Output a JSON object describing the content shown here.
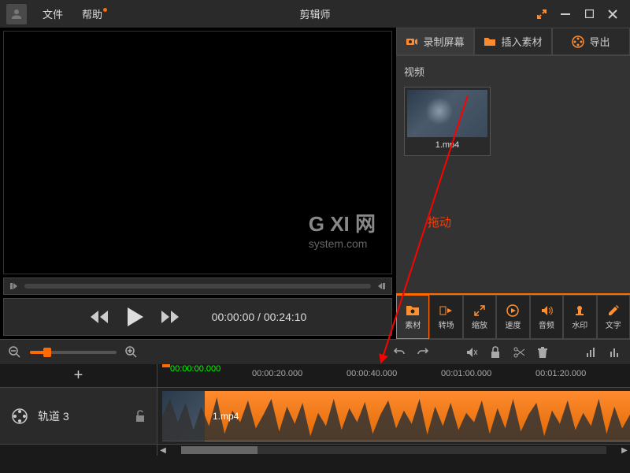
{
  "app": {
    "title": "剪辑师"
  },
  "menu": {
    "file": "文件",
    "help": "帮助"
  },
  "watermark": {
    "line1": "G XI 网",
    "line2": "system.com"
  },
  "transport": {
    "current": "00:00:00",
    "total": "00:24:10"
  },
  "actionTabs": {
    "record": "录制屏幕",
    "import": "插入素材",
    "export": "导出"
  },
  "media": {
    "section": "视频",
    "items": [
      {
        "name": "1.mp4"
      }
    ]
  },
  "dragHint": "拖动",
  "toolTabs": {
    "material": "素材",
    "transition": "转场",
    "scale": "缩放",
    "speed": "速度",
    "audio": "音频",
    "watermark": "水印",
    "text": "文字"
  },
  "ruler": {
    "playhead": "00:00:00.000",
    "ticks": [
      "00:00:20.000",
      "00:00:40.000",
      "00:01:00.000",
      "00:01:20.000"
    ]
  },
  "track": {
    "addLabel": "+",
    "name": "轨道 3",
    "clipName": "1.mp4"
  },
  "colors": {
    "accent": "#ff6b00",
    "bg": "#1a1a1a",
    "panel": "#2a2a2a"
  }
}
